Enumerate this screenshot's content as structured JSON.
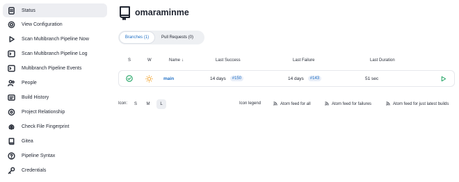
{
  "sidebar": {
    "items": [
      {
        "label": "Status",
        "icon": "document-icon"
      },
      {
        "label": "View Configuration",
        "icon": "gear-icon"
      },
      {
        "label": "Scan Multibranch Pipeline Now",
        "icon": "play-icon"
      },
      {
        "label": "Scan Multibranch Pipeline Log",
        "icon": "terminal-icon"
      },
      {
        "label": "Multibranch Pipeline Events",
        "icon": "terminal-icon"
      },
      {
        "label": "People",
        "icon": "people-icon"
      },
      {
        "label": "Build History",
        "icon": "build-history-icon"
      },
      {
        "label": "Project Relationship",
        "icon": "relationship-icon"
      },
      {
        "label": "Check File Fingerprint",
        "icon": "fingerprint-icon"
      },
      {
        "label": "Gitea",
        "icon": "gitea-icon"
      },
      {
        "label": "Pipeline Syntax",
        "icon": "help-icon"
      },
      {
        "label": "Credentials",
        "icon": "key-icon"
      }
    ]
  },
  "header": {
    "title": "omaraminme",
    "icon": "repository-icon"
  },
  "tabs": [
    {
      "label": "Branches (1)",
      "active": true
    },
    {
      "label": "Pull Requests (0)",
      "active": false
    }
  ],
  "table": {
    "columns": {
      "s": "S",
      "w": "W",
      "name": "Name",
      "sort_arrow": "↓",
      "last_success": "Last Success",
      "last_failure": "Last Failure",
      "last_duration": "Last Duration"
    },
    "rows": [
      {
        "status": "success",
        "weather": "sunny",
        "name": "main",
        "last_success_age": "14 days",
        "last_success_build": "#150",
        "last_failure_age": "14 days",
        "last_failure_build": "#143",
        "last_duration": "51 sec"
      }
    ]
  },
  "footer": {
    "icon_label": "Icon:",
    "sizes": [
      {
        "label": "S",
        "active": false
      },
      {
        "label": "M",
        "active": false
      },
      {
        "label": "L",
        "active": true
      }
    ],
    "icon_legend": "Icon legend",
    "feed_all": "Atom feed for all",
    "feed_failures": "Atom feed for failures",
    "feed_latest": "Atom feed for just latest builds"
  },
  "colors": {
    "success": "#1ea362",
    "link": "#1f6fc5",
    "weather": "#f2a93b"
  }
}
